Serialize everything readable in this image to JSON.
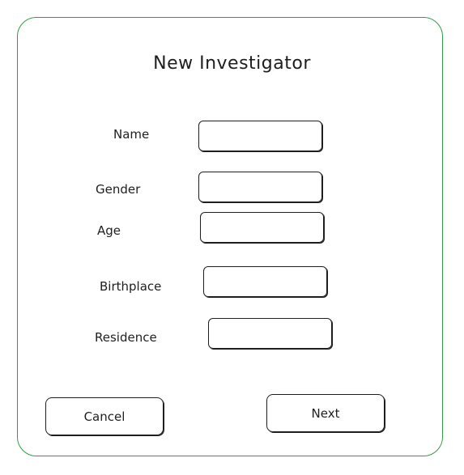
{
  "dialog": {
    "title": "New Investigator"
  },
  "form": {
    "fields": [
      {
        "label": "Name",
        "value": ""
      },
      {
        "label": "Gender",
        "value": ""
      },
      {
        "label": "Age",
        "value": ""
      },
      {
        "label": "Birthplace",
        "value": ""
      },
      {
        "label": "Residence",
        "value": ""
      }
    ]
  },
  "actions": {
    "cancel_label": "Cancel",
    "next_label": "Next"
  },
  "colors": {
    "panel_border": "#2f9e44",
    "stroke": "#1e1e1e"
  }
}
